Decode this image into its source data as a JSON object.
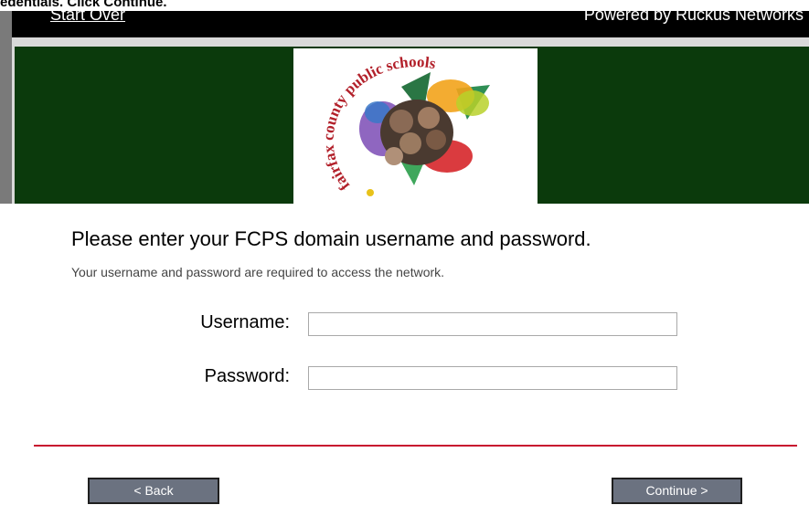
{
  "caption": "edentials. Click Continue.",
  "topbar": {
    "start_over": "Start Over",
    "powered_by": "Powered by Ruckus Networks"
  },
  "logo": {
    "arc_text": "fairfax county public schools"
  },
  "form": {
    "heading": "Please enter your FCPS domain username and password.",
    "subtext": "Your username and password are required to access the network.",
    "username_label": "Username:",
    "username_value": "",
    "password_label": "Password:",
    "password_value": ""
  },
  "buttons": {
    "back": "< Back",
    "continue": "Continue >"
  },
  "colors": {
    "banner": "#0b3a0c",
    "divider": "#c8102e",
    "button": "#6b7280"
  }
}
